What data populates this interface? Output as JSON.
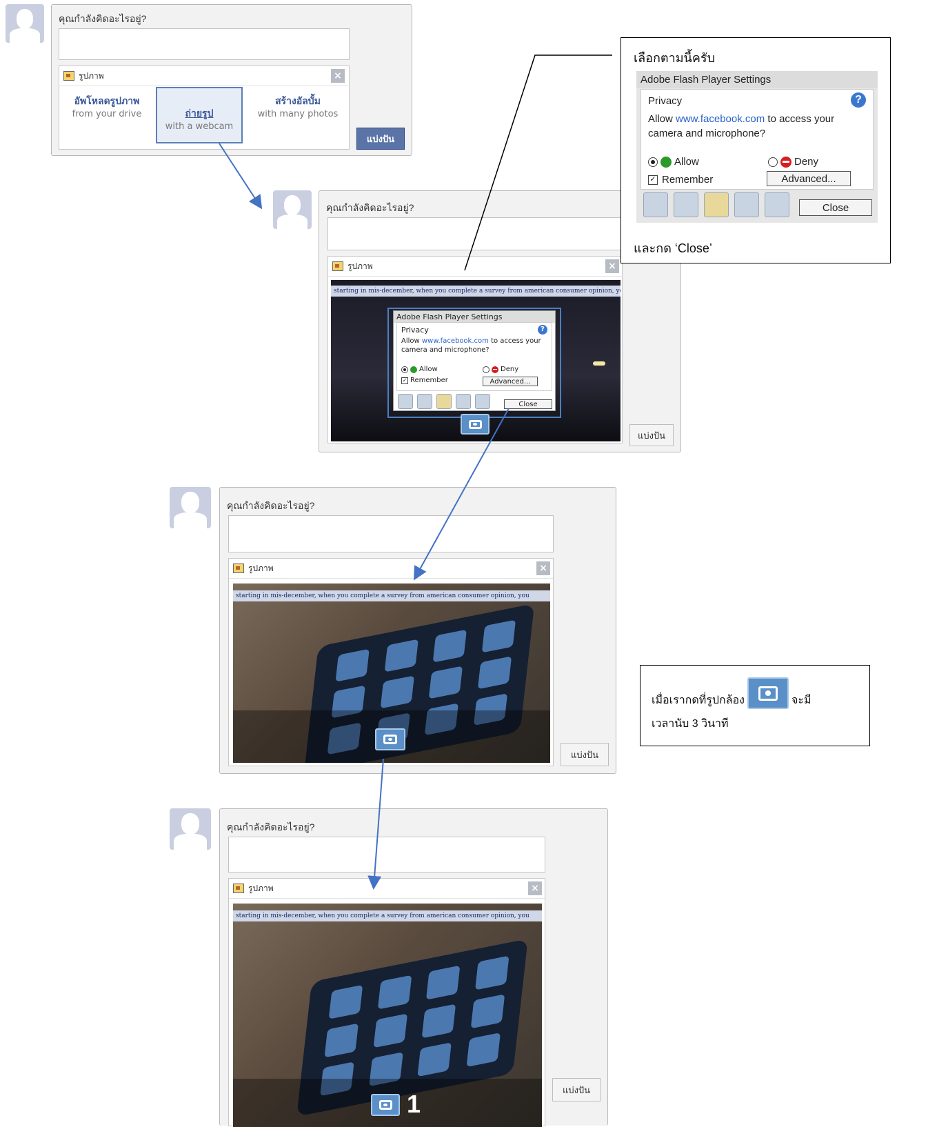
{
  "composer": {
    "prompt": "คุณกำลังคิดอะไรอยู่?",
    "attachment_title": "รูปภาพ",
    "share_label": "แบ่งปัน",
    "close_glyph": "×"
  },
  "options": [
    {
      "title": "อัพโหลดรูปภาพ",
      "sub": "from your drive"
    },
    {
      "title": "ถ่ายรูป",
      "sub": "with a webcam",
      "selected": true
    },
    {
      "title": "สร้างอัลบั้ม",
      "sub": "with many photos"
    }
  ],
  "webcam": {
    "banner": "starting in mis-december, when you complete a survey from american consumer opinion, you",
    "countdown": "1"
  },
  "flash": {
    "title": "Adobe Flash Player Settings",
    "section": "Privacy",
    "q_prefix": "Allow ",
    "q_domain": "www.facebook.com",
    "q_suffix": " to access your camera and microphone?",
    "allow": "Allow",
    "deny": "Deny",
    "remember": "Remember",
    "advanced": "Advanced...",
    "close": "Close",
    "help_glyph": "?",
    "selected": "Allow",
    "remember_checked": true
  },
  "callouts": {
    "flash_top": "เลือกตามนี้ครับ",
    "flash_bottom": "และกด ‘Close’",
    "camera_before": "เมื่อเรากดที่รูปกล้อง",
    "camera_after": "จะมี",
    "camera_line2": "เวลานับ 3 วินาที"
  },
  "colors": {
    "link": "#3b5998",
    "share_active": "#5b74a8",
    "arrow": "#4472c4",
    "flash_link": "#2a63c8"
  },
  "icons": [
    "avatar-icon",
    "photo-icon",
    "close-icon",
    "camera-icon",
    "help-icon",
    "check-icon",
    "deny-icon"
  ]
}
